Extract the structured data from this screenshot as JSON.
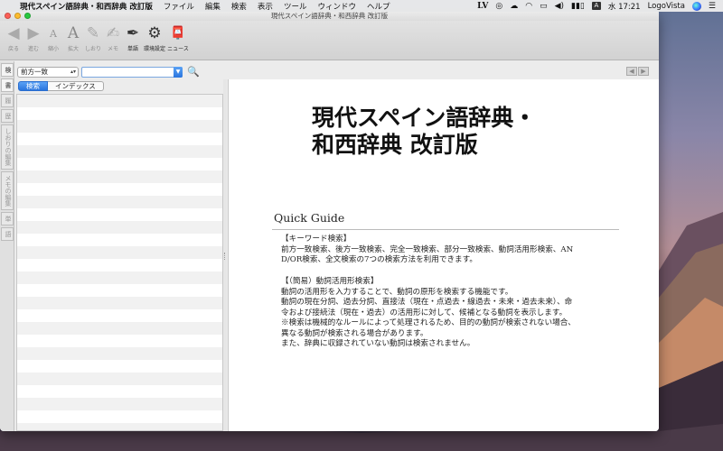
{
  "menubar": {
    "app_name": "現代スペイン語辞典・和西辞典 改訂版",
    "menus": [
      "ファイル",
      "編集",
      "検索",
      "表示",
      "ツール",
      "ウィンドウ",
      "ヘルプ"
    ],
    "right": {
      "lv": "LV",
      "input_badge": "A",
      "clock": "水 17:21",
      "user": "LogoVista"
    }
  },
  "window": {
    "title": "現代スペイン語辞典・和西辞典 改訂版",
    "toolbar": [
      {
        "label": "戻る",
        "icon": "◀"
      },
      {
        "label": "進む",
        "icon": "▶"
      },
      {
        "label": "縮小",
        "icon": "A"
      },
      {
        "label": "拡大",
        "icon": "A"
      },
      {
        "label": "しおり",
        "icon": "✎"
      },
      {
        "label": "メモ",
        "icon": "✍"
      },
      {
        "label": "単語",
        "icon": "✒"
      },
      {
        "label": "環境設定",
        "icon": "⚙"
      },
      {
        "label": "ニュース",
        "icon": "📮"
      }
    ]
  },
  "sidebar_tabs": [
    "検",
    "書",
    "履",
    "歴",
    "しおりの編集",
    "メモの編集",
    "単",
    "語"
  ],
  "search": {
    "mode": "前方一致",
    "query": "",
    "tabs": [
      "検索",
      "インデックス"
    ]
  },
  "content": {
    "dict_title_line1": "現代スペイン語辞典・",
    "dict_title_line2": "和西辞典 改訂版",
    "quick_guide_title": "Quick Guide",
    "section1": {
      "heading": "【キーワード検索】",
      "lines": [
        "前方一致検索、後方一致検索、完全一致検索、部分一致検索、動詞活用形検索、AN",
        "D/OR検索、全文検索の7つの検索方法を利用できます。"
      ]
    },
    "section2": {
      "heading": "【（簡易）動詞活用形検索】",
      "lines": [
        "動詞の活用形を入力することで、動詞の原形を検索する機能です。",
        "動詞の現在分詞、過去分詞、直接法（現在・点過去・線過去・未来・過去未来）、命",
        "令および接続法（現在・過去）の活用形に対して、候補となる動詞を表示します。",
        "※検索は機械的なルールによって処理されるため、目的の動詞が検索されない場合、",
        "異なる動詞が検索される場合があります。",
        "また、辞典に収録されていない動詞は検索されません。"
      ]
    }
  }
}
